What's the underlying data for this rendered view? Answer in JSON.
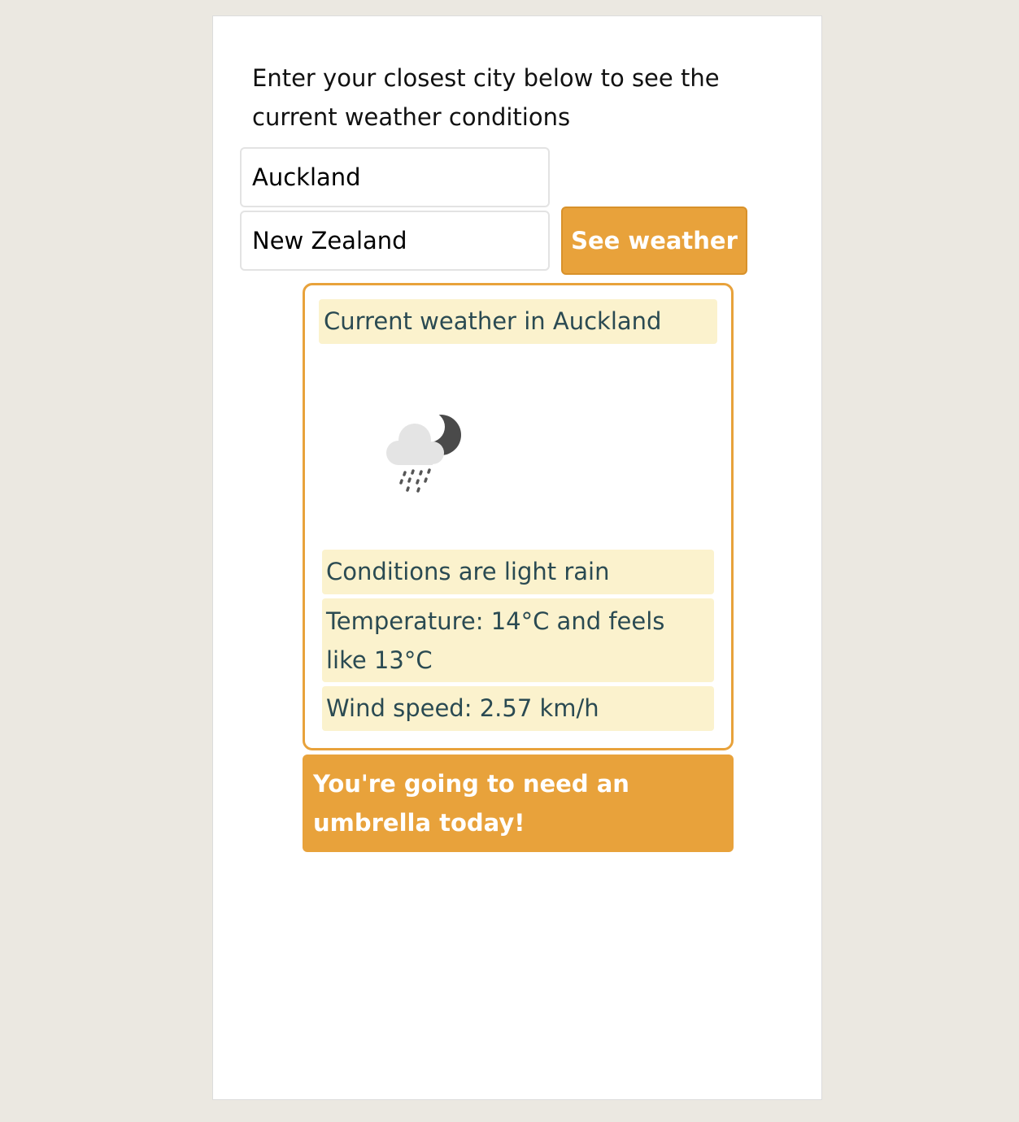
{
  "intro": {
    "text": "Enter your closest city below to see the current weather conditions"
  },
  "form": {
    "city_value": "Auckland",
    "country_value": "New Zealand",
    "submit_label": "See weather"
  },
  "weather": {
    "title": "Current weather in Auckland",
    "icon": "light-rain-night-icon",
    "conditions": "Conditions are light rain",
    "temperature": "Temperature: 14°C and feels like 13°C",
    "wind": "Wind speed: 2.57 km/h"
  },
  "advice": {
    "text": "You're going to need an umbrella today!"
  },
  "colors": {
    "page_background": "#ebe8e1",
    "accent": "#e8a23b",
    "highlight": "#fbf2cd",
    "text_dark": "#2a4a52"
  }
}
